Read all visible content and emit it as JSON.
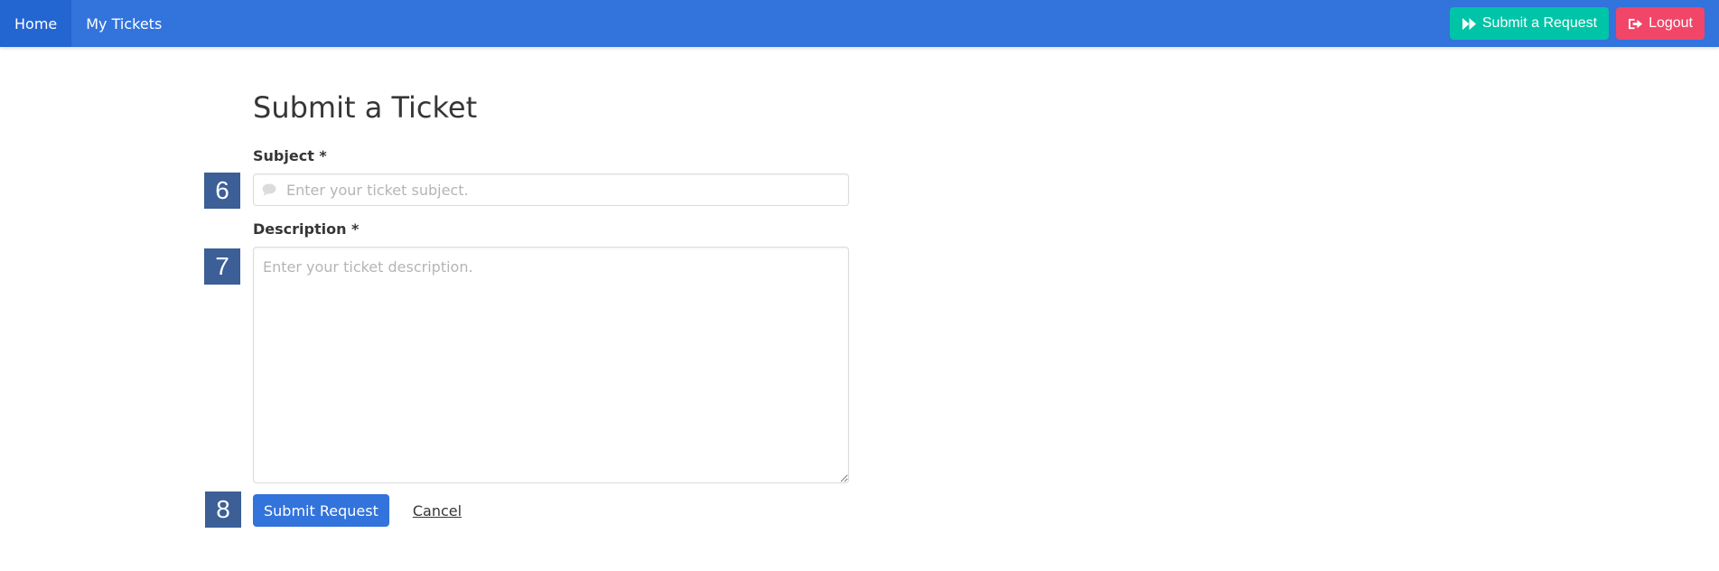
{
  "nav": {
    "items": [
      {
        "label": "Home",
        "active": true
      },
      {
        "label": "My Tickets",
        "active": false
      }
    ],
    "submit_request_label": "Submit a Request",
    "logout_label": "Logout",
    "submit_request_icon": "fast-forward-icon",
    "logout_icon": "sign-out-icon"
  },
  "form": {
    "title": "Submit a Ticket",
    "subject_label": "Subject *",
    "subject_placeholder": "Enter your ticket subject.",
    "subject_value": "",
    "subject_icon": "comment-icon",
    "description_label": "Description *",
    "description_placeholder": "Enter your ticket description.",
    "description_value": "",
    "submit_label": "Submit Request",
    "cancel_label": "Cancel"
  },
  "badges": [
    "6",
    "7",
    "8"
  ],
  "colors": {
    "navbar": "#3273dc",
    "submit_request_button": "#00c4a7",
    "logout_button": "#f14668",
    "submit_button": "#3273dc",
    "badge": "#3b5f96"
  }
}
